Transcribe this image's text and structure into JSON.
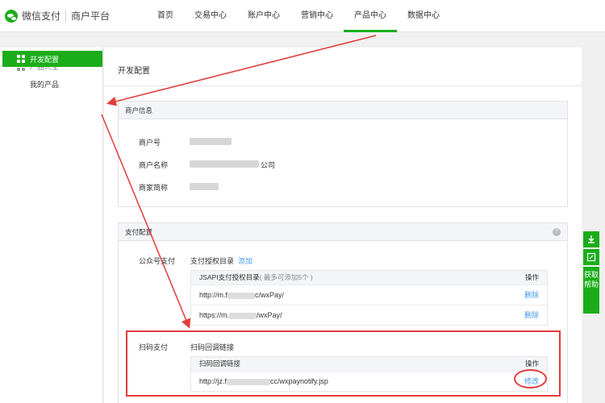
{
  "brand": {
    "name": "微信支付",
    "sub": "商户平台"
  },
  "nav": [
    {
      "label": "首页",
      "active": false
    },
    {
      "label": "交易中心",
      "active": false
    },
    {
      "label": "账户中心",
      "active": false
    },
    {
      "label": "营销中心",
      "active": false
    },
    {
      "label": "产品中心",
      "active": true
    },
    {
      "label": "数据中心",
      "active": false
    }
  ],
  "sidebar": {
    "group_label": "产品大全",
    "my_products": "我的产品",
    "active_label": "开发配置"
  },
  "page": {
    "title": "开发配置"
  },
  "merchant_info": {
    "title": "商户信息",
    "fields": [
      {
        "label": "商户号",
        "value_suffix": ""
      },
      {
        "label": "商户名称",
        "value_suffix": "公司"
      },
      {
        "label": "商家简称",
        "value_suffix": ""
      }
    ]
  },
  "pay_config": {
    "title": "支付配置",
    "help": "?",
    "jsapi": {
      "row_label": "公众号支付",
      "dir_label": "支付授权目录",
      "add_label": "添加",
      "table_header": "JSAPI支付授权目录",
      "table_hint": "( 最多可添加5个 )",
      "op_header": "操作",
      "rows": [
        {
          "prefix": "http://m.f",
          "suffix": "c/wxPay/",
          "op": "删除"
        },
        {
          "prefix": "https://m.",
          "suffix": "/wxPay/",
          "op": "删除"
        }
      ]
    },
    "native": {
      "row_label": "扫码支付",
      "link_label": "扫码回调链接",
      "table_header": "扫码回调链接",
      "op_header": "操作",
      "rows": [
        {
          "prefix": "http://jz.f",
          "suffix": "cc/wxpaynotify.jsp",
          "op": "修改"
        }
      ]
    }
  },
  "float_panel": {
    "help_label": "获取帮助"
  },
  "colors": {
    "accent": "#1aad19",
    "link": "#459ae9",
    "annotation": "#e23b3b"
  }
}
